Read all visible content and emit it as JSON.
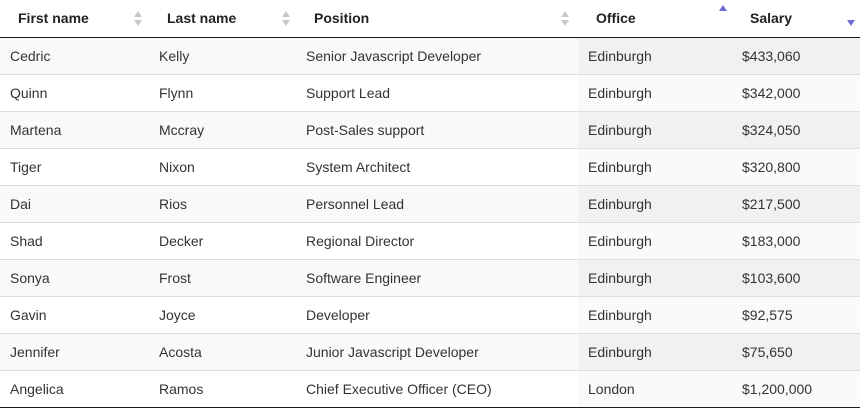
{
  "table": {
    "columns": [
      {
        "label": "First name",
        "sort": "none"
      },
      {
        "label": "Last name",
        "sort": "none"
      },
      {
        "label": "Position",
        "sort": "none"
      },
      {
        "label": "Office",
        "sort": "asc"
      },
      {
        "label": "Salary",
        "sort": "desc"
      }
    ],
    "rows": [
      [
        "Cedric",
        "Kelly",
        "Senior Javascript Developer",
        "Edinburgh",
        "$433,060"
      ],
      [
        "Quinn",
        "Flynn",
        "Support Lead",
        "Edinburgh",
        "$342,000"
      ],
      [
        "Martena",
        "Mccray",
        "Post-Sales support",
        "Edinburgh",
        "$324,050"
      ],
      [
        "Tiger",
        "Nixon",
        "System Architect",
        "Edinburgh",
        "$320,800"
      ],
      [
        "Dai",
        "Rios",
        "Personnel Lead",
        "Edinburgh",
        "$217,500"
      ],
      [
        "Shad",
        "Decker",
        "Regional Director",
        "Edinburgh",
        "$183,000"
      ],
      [
        "Sonya",
        "Frost",
        "Software Engineer",
        "Edinburgh",
        "$103,600"
      ],
      [
        "Gavin",
        "Joyce",
        "Developer",
        "Edinburgh",
        "$92,575"
      ],
      [
        "Jennifer",
        "Acosta",
        "Junior Javascript Developer",
        "Edinburgh",
        "$75,650"
      ],
      [
        "Angelica",
        "Ramos",
        "Chief Executive Officer (CEO)",
        "London",
        "$1,200,000"
      ]
    ]
  },
  "colors": {
    "sort_active": "#6b6bd6",
    "sort_inactive": "#c8c8c8"
  }
}
